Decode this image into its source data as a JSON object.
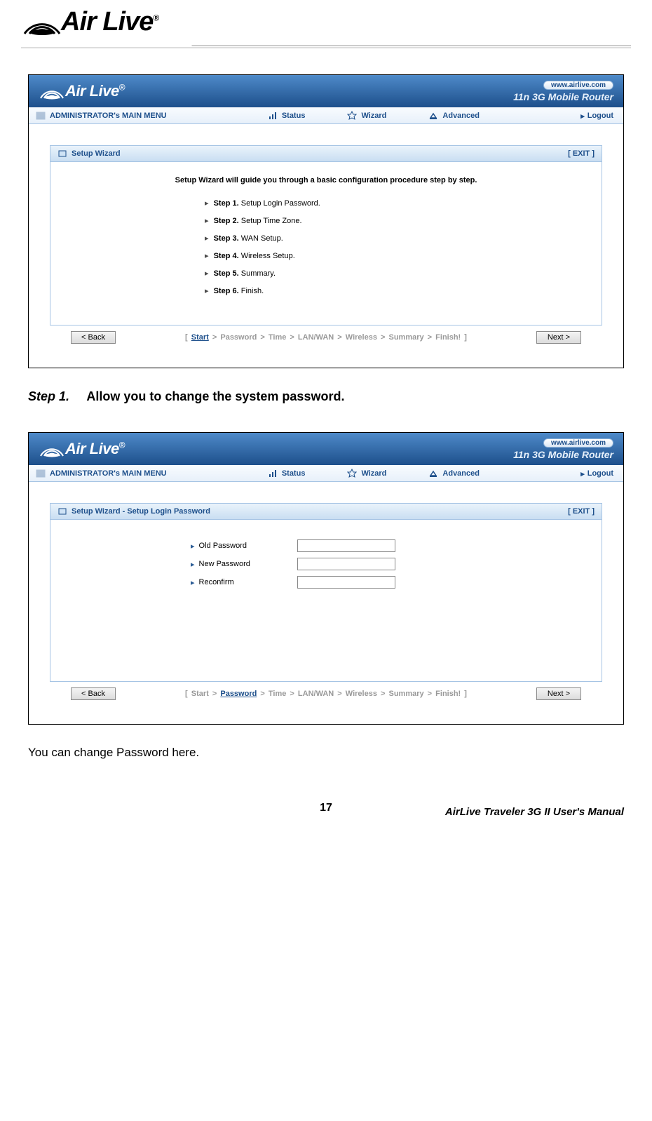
{
  "page_logo_text": "Air Live",
  "screenshots": {
    "common": {
      "url_pill": "www.airlive.com",
      "device_title": "11n 3G Mobile Router",
      "menu_title": "ADMINISTRATOR's MAIN MENU",
      "menu_status": "Status",
      "menu_wizard": "Wizard",
      "menu_advanced": "Advanced",
      "menu_logout": "Logout",
      "exit_label": "[ EXIT ]",
      "back_btn": "< Back",
      "next_btn": "Next >",
      "crumb_prefix": "[ ",
      "crumb_suffix": " ]",
      "crumb_start": "Start",
      "crumb_password": "Password",
      "crumb_time": "Time",
      "crumb_lanwan": "LAN/WAN",
      "crumb_wireless": "Wireless",
      "crumb_summary": "Summary",
      "crumb_finish": "Finish!"
    },
    "s1": {
      "panel_title": "Setup Wizard",
      "intro": "Setup Wizard will guide you through a basic configuration procedure step by step.",
      "steps": [
        {
          "label": "Step 1.",
          "text": "Setup Login Password."
        },
        {
          "label": "Step 2.",
          "text": "Setup Time Zone."
        },
        {
          "label": "Step 3.",
          "text": "WAN Setup."
        },
        {
          "label": "Step 4.",
          "text": "Wireless Setup."
        },
        {
          "label": "Step 5.",
          "text": "Summary."
        },
        {
          "label": "Step 6.",
          "text": "Finish."
        }
      ]
    },
    "s2": {
      "panel_title": "Setup Wizard - Setup Login Password",
      "fields": {
        "old": "Old Password",
        "new": "New Password",
        "reconfirm": "Reconfirm"
      }
    }
  },
  "doc": {
    "step_num": "Step 1.",
    "step_text": "Allow you to change the system password.",
    "body_text": "You can change Password here.",
    "page_num": "17",
    "footer": "AirLive  Traveler  3G  II  User's  Manual"
  }
}
